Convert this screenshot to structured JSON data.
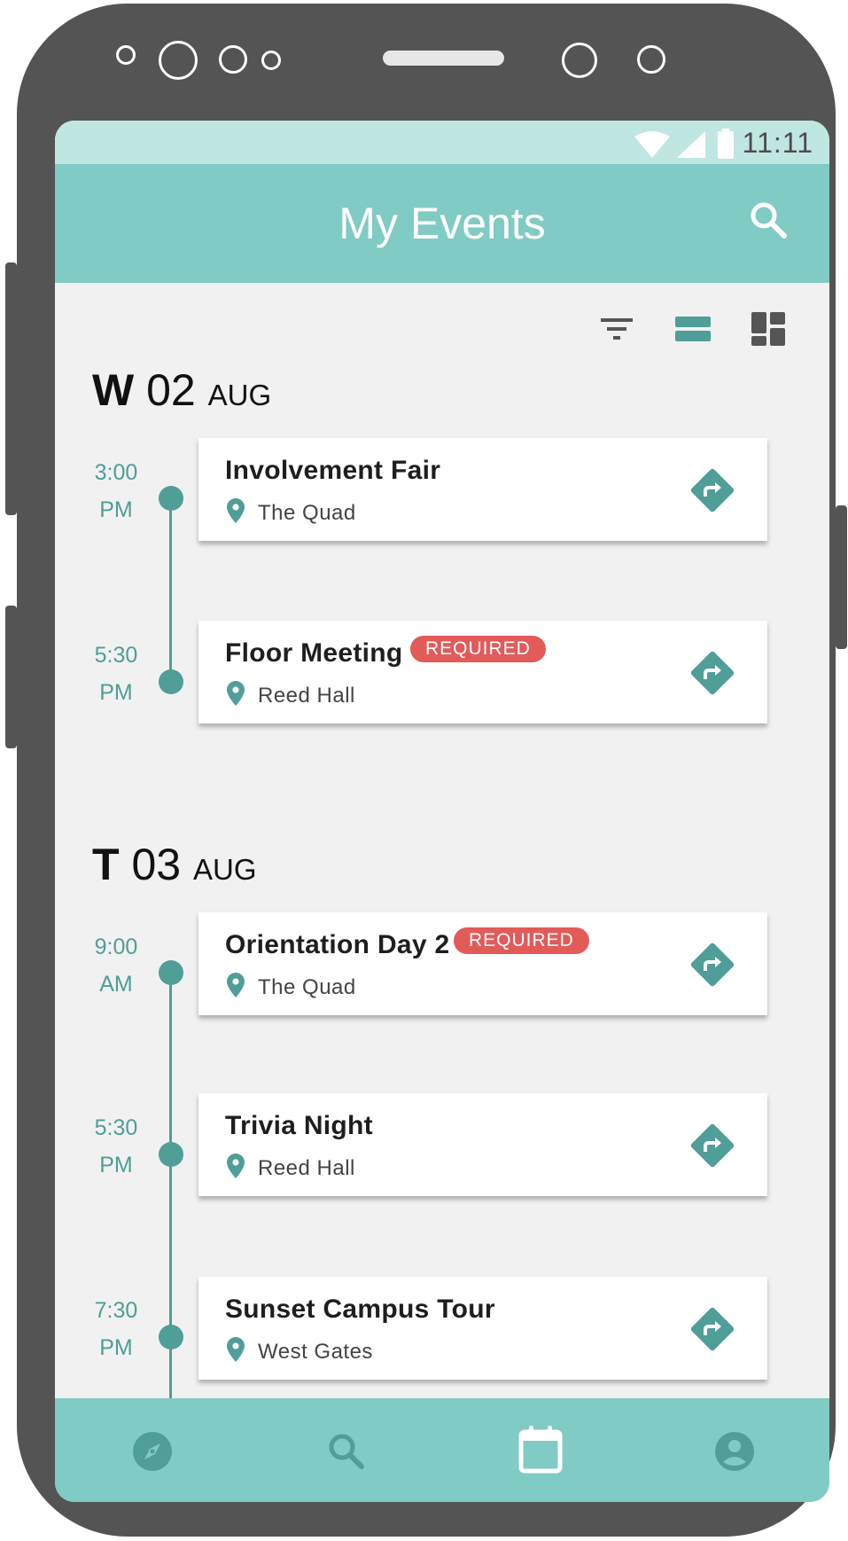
{
  "status_bar": {
    "time": "11:11"
  },
  "app_bar": {
    "title": "My Events",
    "search_icon": "search-icon"
  },
  "toolbar": {
    "filter_icon": "filter-icon",
    "list_view_icon": "list-view-icon",
    "grid_view_icon": "grid-view-icon"
  },
  "days": [
    {
      "dow": "W",
      "date": "02",
      "month": "AUG",
      "events": [
        {
          "time": "3:00",
          "period": "PM",
          "title": "Involvement Fair",
          "location": "The Quad",
          "required": false
        },
        {
          "time": "5:30",
          "period": "PM",
          "title": "Floor Meeting",
          "location": "Reed Hall",
          "required": true,
          "badge": "REQUIRED"
        }
      ]
    },
    {
      "dow": "T",
      "date": "03",
      "month": "AUG",
      "events": [
        {
          "time": "9:00",
          "period": "AM",
          "title": "Orientation Day 2",
          "location": "The Quad",
          "required": true,
          "badge": "REQUIRED"
        },
        {
          "time": "5:30",
          "period": "PM",
          "title": "Trivia Night",
          "location": "Reed Hall",
          "required": false
        },
        {
          "time": "7:30",
          "period": "PM",
          "title": "Sunset Campus Tour",
          "location": "West Gates",
          "required": false
        }
      ]
    }
  ],
  "bottom_nav": {
    "items": [
      "explore-icon",
      "search-icon",
      "calendar-icon",
      "profile-icon"
    ],
    "active": "calendar-icon"
  },
  "colors": {
    "primary": "#80cbc3",
    "primary_dark": "#4f9e97",
    "status_bar": "#c0e6e2",
    "required_badge": "#e25b59",
    "background": "#f1f1f1",
    "device_frame": "#545454"
  }
}
